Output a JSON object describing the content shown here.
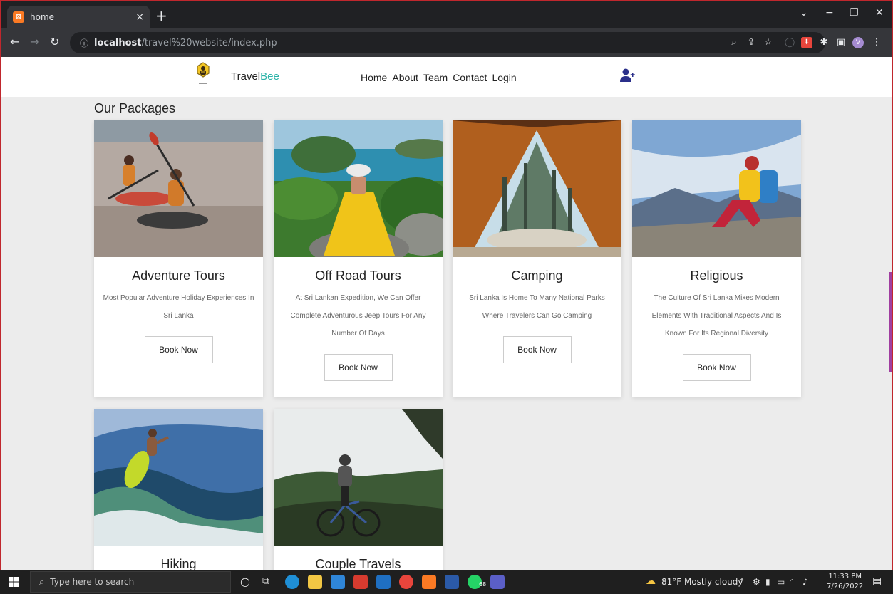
{
  "browser": {
    "tab_title": "home",
    "tab_close": "×",
    "new_tab": "+",
    "url_host": "localhost",
    "url_path": "/travel%20website/index.php",
    "window_controls": [
      "⌄",
      "−",
      "❐",
      "✕"
    ]
  },
  "site": {
    "brand_prefix": "Travel",
    "brand_suffix": "Bee",
    "nav": [
      "Home",
      "About",
      "Team",
      "Contact",
      "Login"
    ]
  },
  "packages": {
    "title": "Our Packages",
    "book_label": "Book Now",
    "items": [
      {
        "name": "Adventure Tours",
        "description": "Most Popular Adventure Holiday Experiences In Sri Lanka",
        "image": "kayaking-photo"
      },
      {
        "name": "Off Road Tours",
        "description": "At Sri Lankan Expedition, We Can Offer Complete Adventurous Jeep Tours For Any Number Of Days",
        "image": "island-viewpoint-photo"
      },
      {
        "name": "Camping",
        "description": "Sri Lanka Is Home To Many National Parks Where Travelers Can Go Camping",
        "image": "tent-forest-photo"
      },
      {
        "name": "Religious",
        "description": "The Culture Of Sri Lanka Mixes Modern Elements With Traditional Aspects And Is Known For Its Regional Diversity",
        "image": "hiker-mountain-photo"
      },
      {
        "name": "Hiking",
        "description": "",
        "image": "surfer-photo"
      },
      {
        "name": "Couple Travels",
        "description": "",
        "image": "mountain-biker-photo"
      }
    ]
  },
  "taskbar": {
    "search_placeholder": "Type here to search",
    "weather": "81°F  Mostly cloudy",
    "time": "11:33 PM",
    "date": "7/26/2022",
    "whatsapp_badge": "68"
  }
}
